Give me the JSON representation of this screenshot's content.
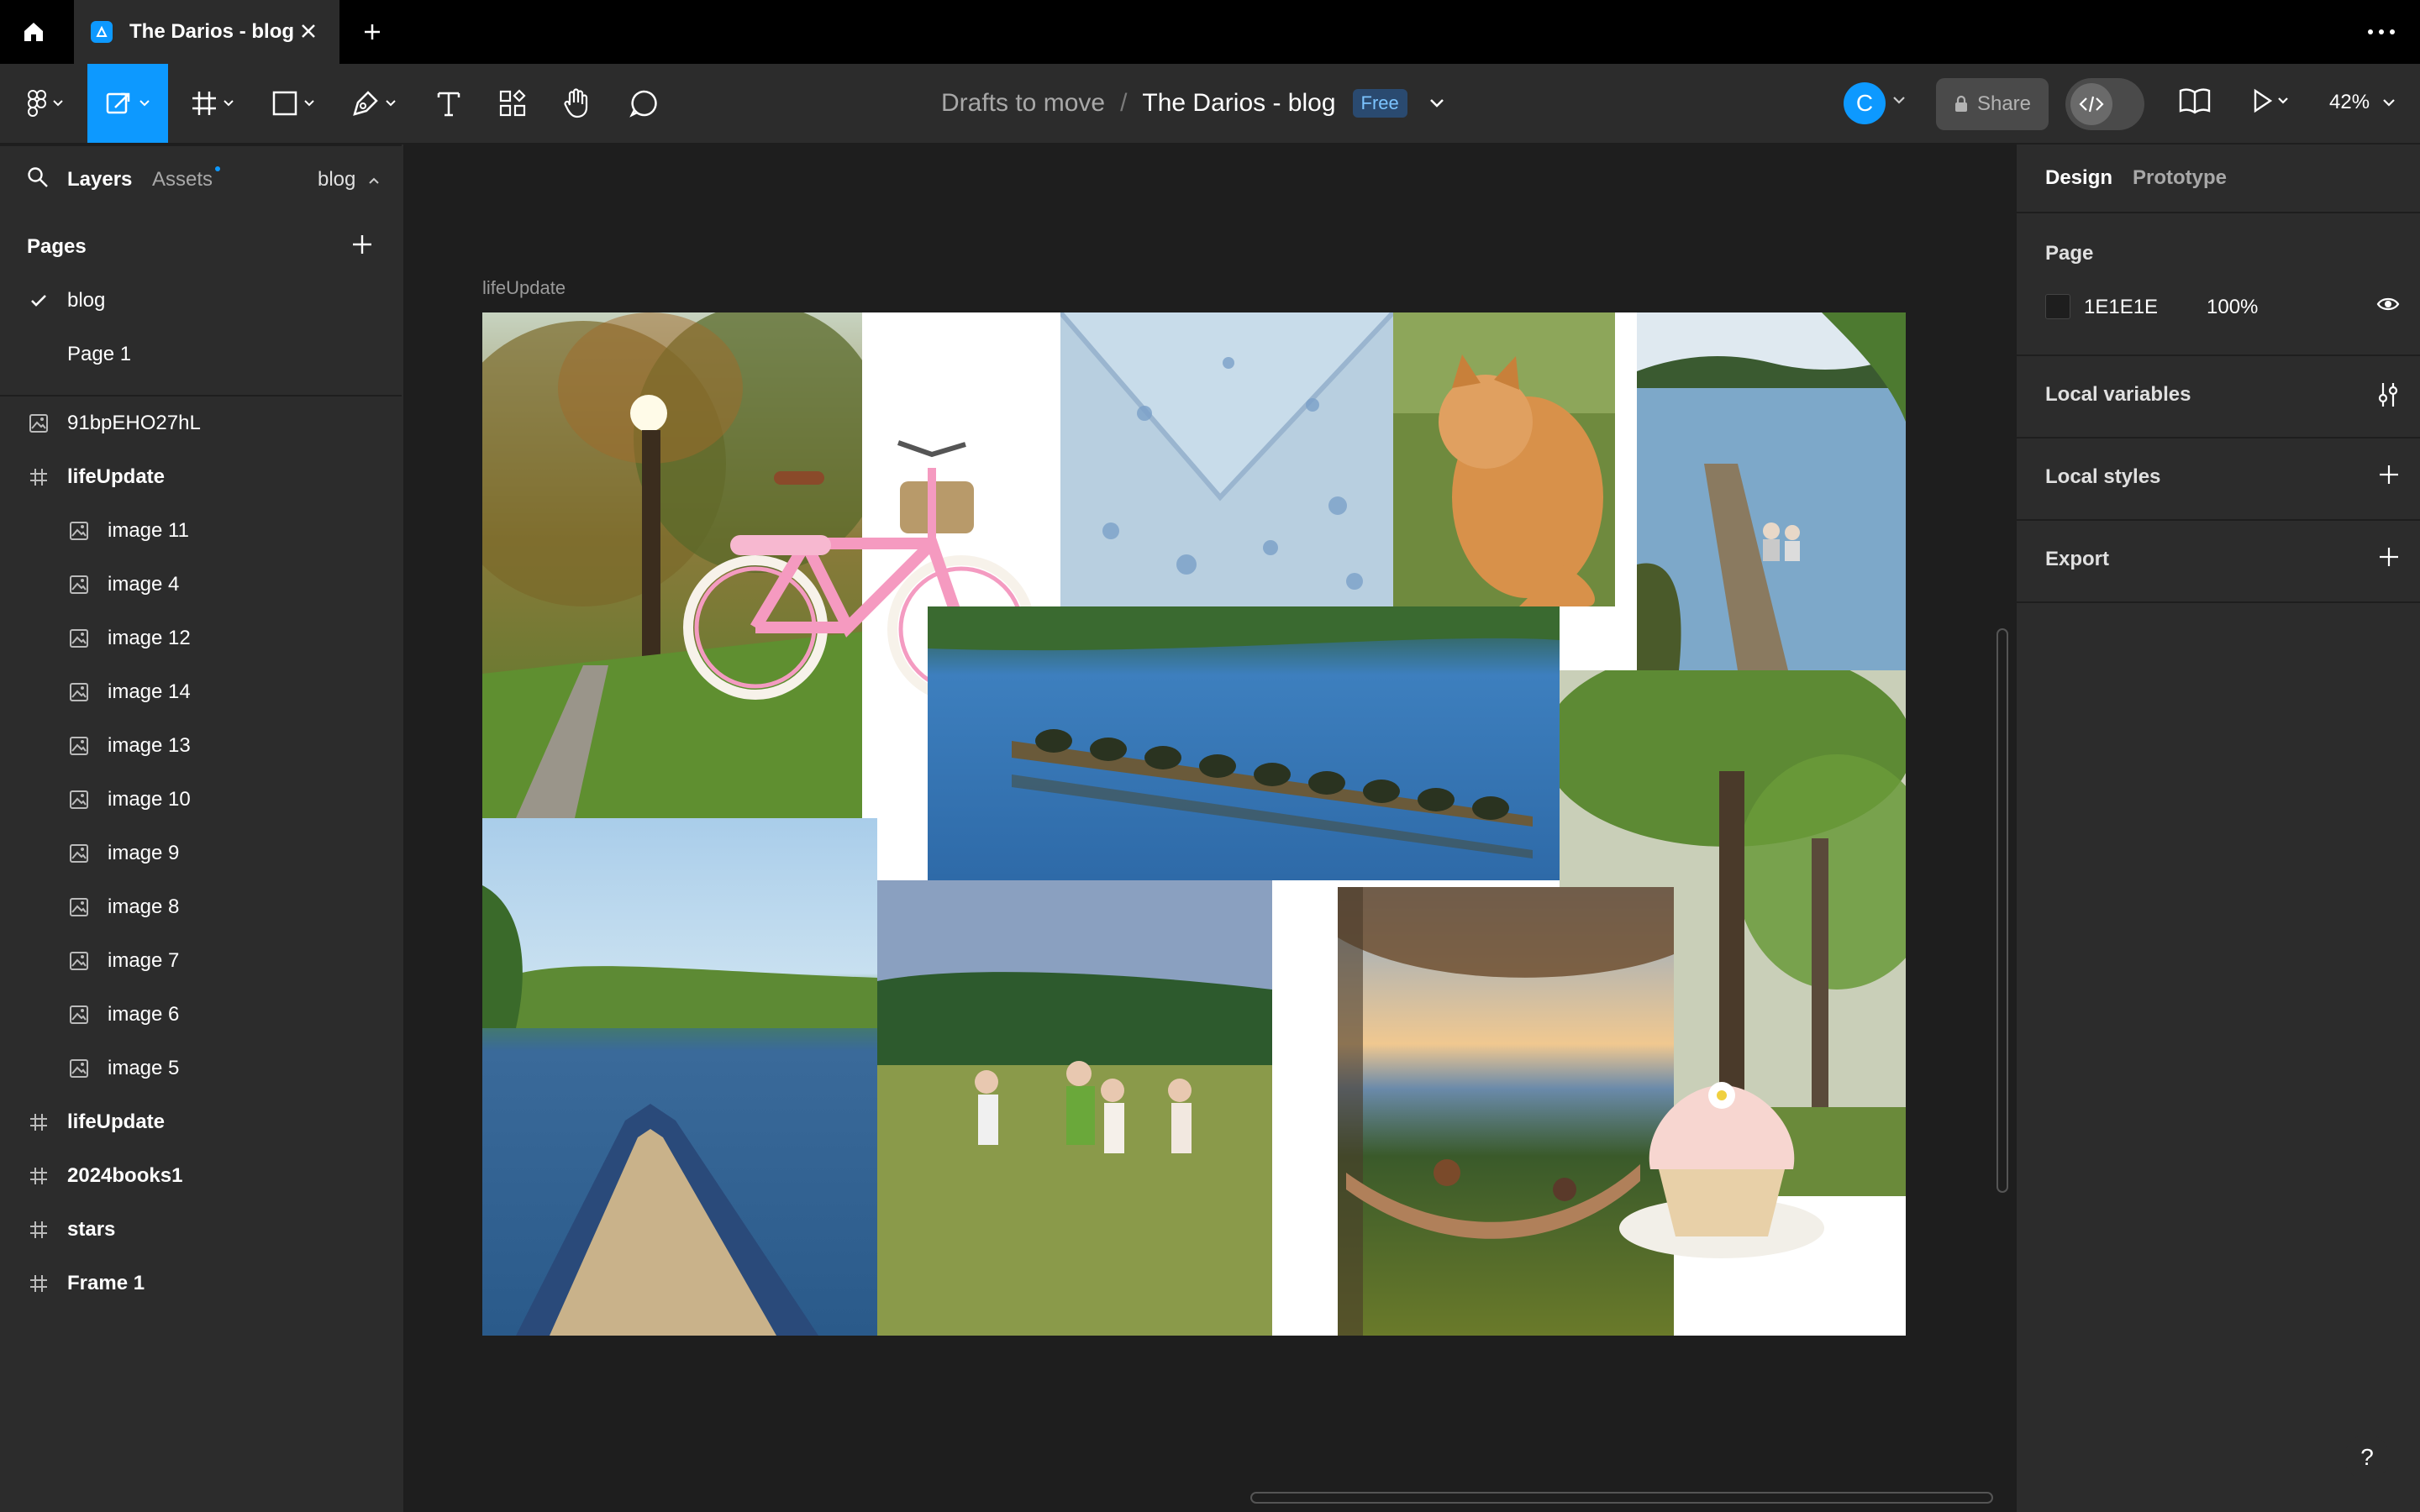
{
  "tabbar": {
    "tab_title": "The Darios - blog",
    "home_icon": "home-icon",
    "close_icon": "close-icon",
    "new_tab_icon": "plus-icon",
    "more_icon": "more-dots-icon"
  },
  "toolbar": {
    "tools": [
      "main-menu",
      "move",
      "frame",
      "shape",
      "pen",
      "text",
      "resources",
      "hand",
      "comment"
    ],
    "folder": "Drafts to move",
    "separator": "/",
    "file_name": "The Darios - blog",
    "plan_badge": "Free",
    "avatar_initial": "C",
    "share_label": "Share",
    "zoom_label": "42%"
  },
  "left_panel": {
    "tabs": [
      "Layers",
      "Assets"
    ],
    "page_selector": "blog",
    "pages_header": "Pages",
    "pages": [
      {
        "label": "blog",
        "selected": true
      },
      {
        "label": "Page 1",
        "selected": false
      }
    ],
    "layers": [
      {
        "label": "91bpEHO27hL",
        "type": "image",
        "indent": 0,
        "bold": false
      },
      {
        "label": "lifeUpdate",
        "type": "frame",
        "indent": 0,
        "bold": true
      },
      {
        "label": "image 11",
        "type": "image",
        "indent": 1,
        "bold": false
      },
      {
        "label": "image 4",
        "type": "image",
        "indent": 1,
        "bold": false
      },
      {
        "label": "image 12",
        "type": "image",
        "indent": 1,
        "bold": false
      },
      {
        "label": "image 14",
        "type": "image",
        "indent": 1,
        "bold": false
      },
      {
        "label": "image 13",
        "type": "image",
        "indent": 1,
        "bold": false
      },
      {
        "label": "image 10",
        "type": "image",
        "indent": 1,
        "bold": false
      },
      {
        "label": "image 9",
        "type": "image",
        "indent": 1,
        "bold": false
      },
      {
        "label": "image 8",
        "type": "image",
        "indent": 1,
        "bold": false
      },
      {
        "label": "image 7",
        "type": "image",
        "indent": 1,
        "bold": false
      },
      {
        "label": "image 6",
        "type": "image",
        "indent": 1,
        "bold": false
      },
      {
        "label": "image 5",
        "type": "image",
        "indent": 1,
        "bold": false
      },
      {
        "label": "lifeUpdate",
        "type": "frame",
        "indent": 0,
        "bold": true
      },
      {
        "label": "2024books1",
        "type": "frame",
        "indent": 0,
        "bold": true
      },
      {
        "label": "stars",
        "type": "frame",
        "indent": 0,
        "bold": true
      },
      {
        "label": "Frame 1",
        "type": "frame",
        "indent": 0,
        "bold": true
      }
    ]
  },
  "right_panel": {
    "tabs": [
      "Design",
      "Prototype"
    ],
    "page_section": "Page",
    "page_color_hex": "1E1E1E",
    "page_opacity": "100%",
    "sections": [
      "Local variables",
      "Local styles",
      "Export"
    ]
  },
  "canvas": {
    "frame_label": "lifeUpdate",
    "images": [
      "park-with-sunlit-tree",
      "pink-bicycle-with-basket",
      "blue-floral-fabric",
      "orange-fluffy-cat",
      "kids-on-lake-dock",
      "turtles-on-log",
      "misty-forest",
      "lake-canoe-view",
      "kids-running-in-meadow",
      "hammock-at-sunset",
      "frosted-cupcake"
    ]
  },
  "colors": {
    "accent": "#0d99ff",
    "toolbar_bg": "#2c2c2c",
    "canvas_bg": "#1e1e1e",
    "tabbar_bg": "#000000"
  }
}
